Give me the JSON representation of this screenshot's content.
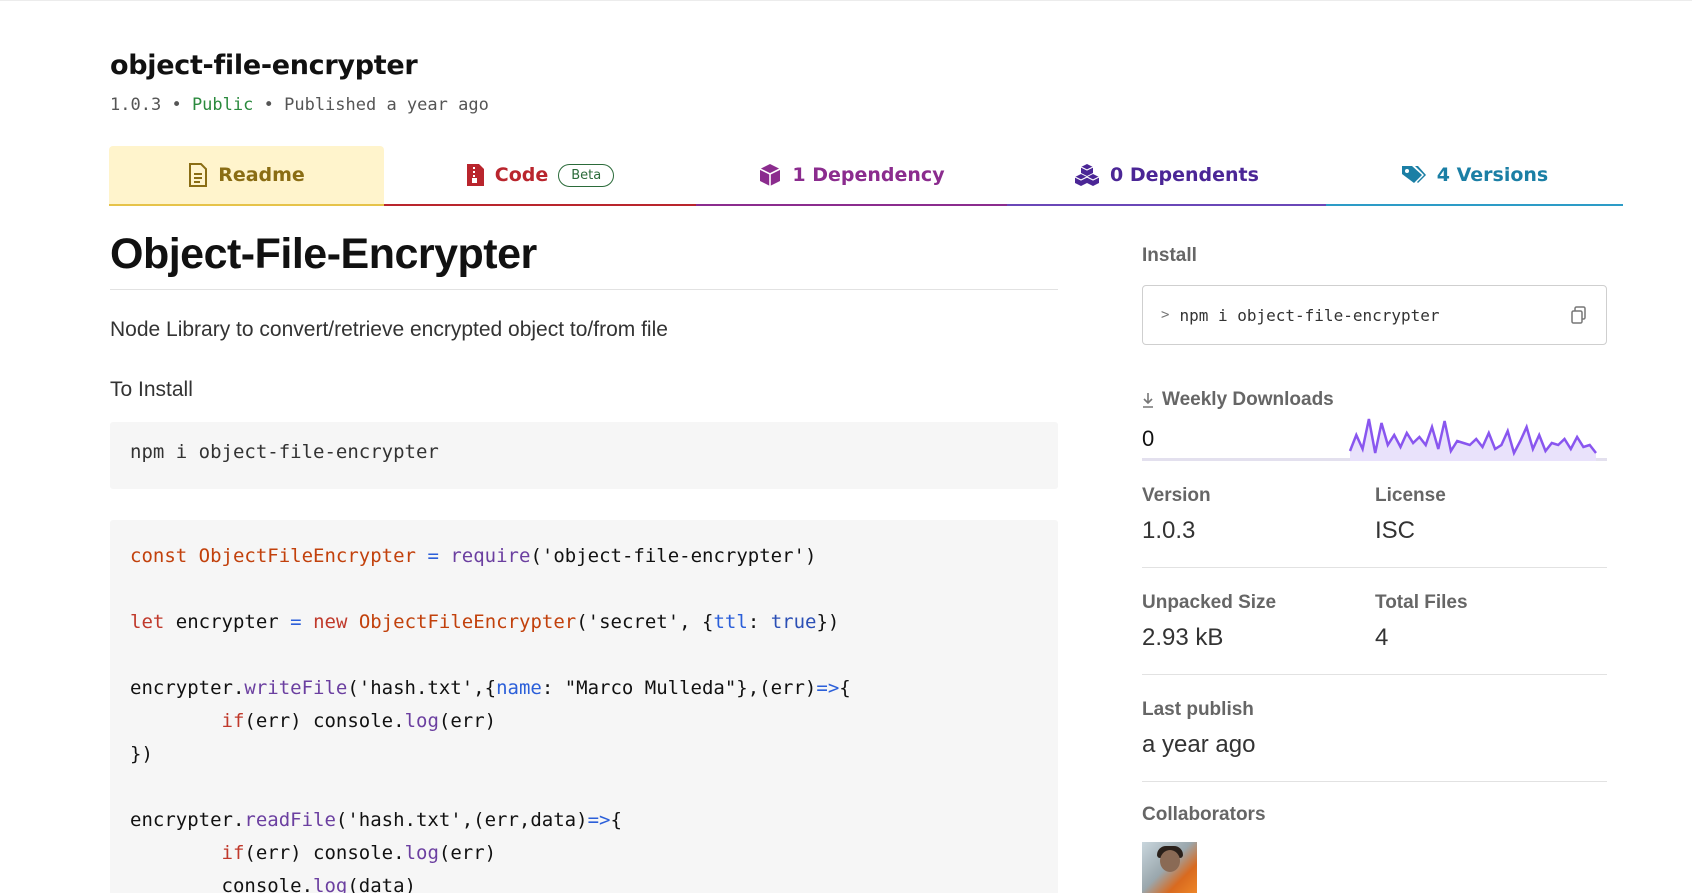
{
  "package": {
    "name": "object-file-encrypter",
    "version": "1.0.3",
    "sep1": "•",
    "visibility": "Public",
    "sep2": "•",
    "published": "Published a year ago"
  },
  "tabs": {
    "readme": "Readme",
    "code": "Code",
    "code_badge": "Beta",
    "dependency": "1 Dependency",
    "dependents": "0 Dependents",
    "versions": "4 Versions"
  },
  "readme": {
    "title": "Object-File-Encrypter",
    "description": "Node Library to convert/retrieve encrypted object to/from file",
    "install_heading": "To Install",
    "install_command": "npm i object-file-encrypter",
    "code_lines": [
      "const ObjectFileEncrypter = require('object-file-encrypter')",
      "",
      "let encrypter = new ObjectFileEncrypter('secret', {ttl: true})",
      "",
      "encrypter.writeFile('hash.txt',{name: \"Marco Mulleda\"},(err)=>{",
      "        if(err) console.log(err)",
      "})",
      "",
      "encrypter.readFile('hash.txt',(err,data)=>{",
      "        if(err) console.log(err)",
      "        console.log(data)"
    ]
  },
  "sidebar": {
    "install_label": "Install",
    "install_prompt": ">",
    "install_command": "npm i object-file-encrypter",
    "weekly_downloads_label": "Weekly Downloads",
    "weekly_downloads_value": "0",
    "weekly_downloads_series": [
      0.15,
      0.55,
      0.2,
      0.95,
      0.1,
      0.85,
      0.3,
      0.55,
      0.25,
      0.6,
      0.35,
      0.5,
      0.3,
      0.75,
      0.2,
      0.9,
      0.15,
      0.4,
      0.35,
      0.3,
      0.45,
      0.25,
      0.6,
      0.2,
      0.3,
      0.65,
      0.1,
      0.4,
      0.75,
      0.2,
      0.55,
      0.15,
      0.35,
      0.3,
      0.45,
      0.2,
      0.5,
      0.25,
      0.3,
      0.1
    ],
    "version_label": "Version",
    "version_value": "1.0.3",
    "license_label": "License",
    "license_value": "ISC",
    "unpacked_label": "Unpacked Size",
    "unpacked_value": "2.93 kB",
    "files_label": "Total Files",
    "files_value": "4",
    "last_publish_label": "Last publish",
    "last_publish_value": "a year ago",
    "collaborators_label": "Collaborators"
  },
  "colors": {
    "readme_tab": "#8a6d14",
    "code_tab": "#b9252d",
    "dependency_tab": "#8b2c8e",
    "dependents_tab": "#4b2696",
    "versions_tab": "#1b7fa5",
    "sparkline": "#8956ef"
  }
}
